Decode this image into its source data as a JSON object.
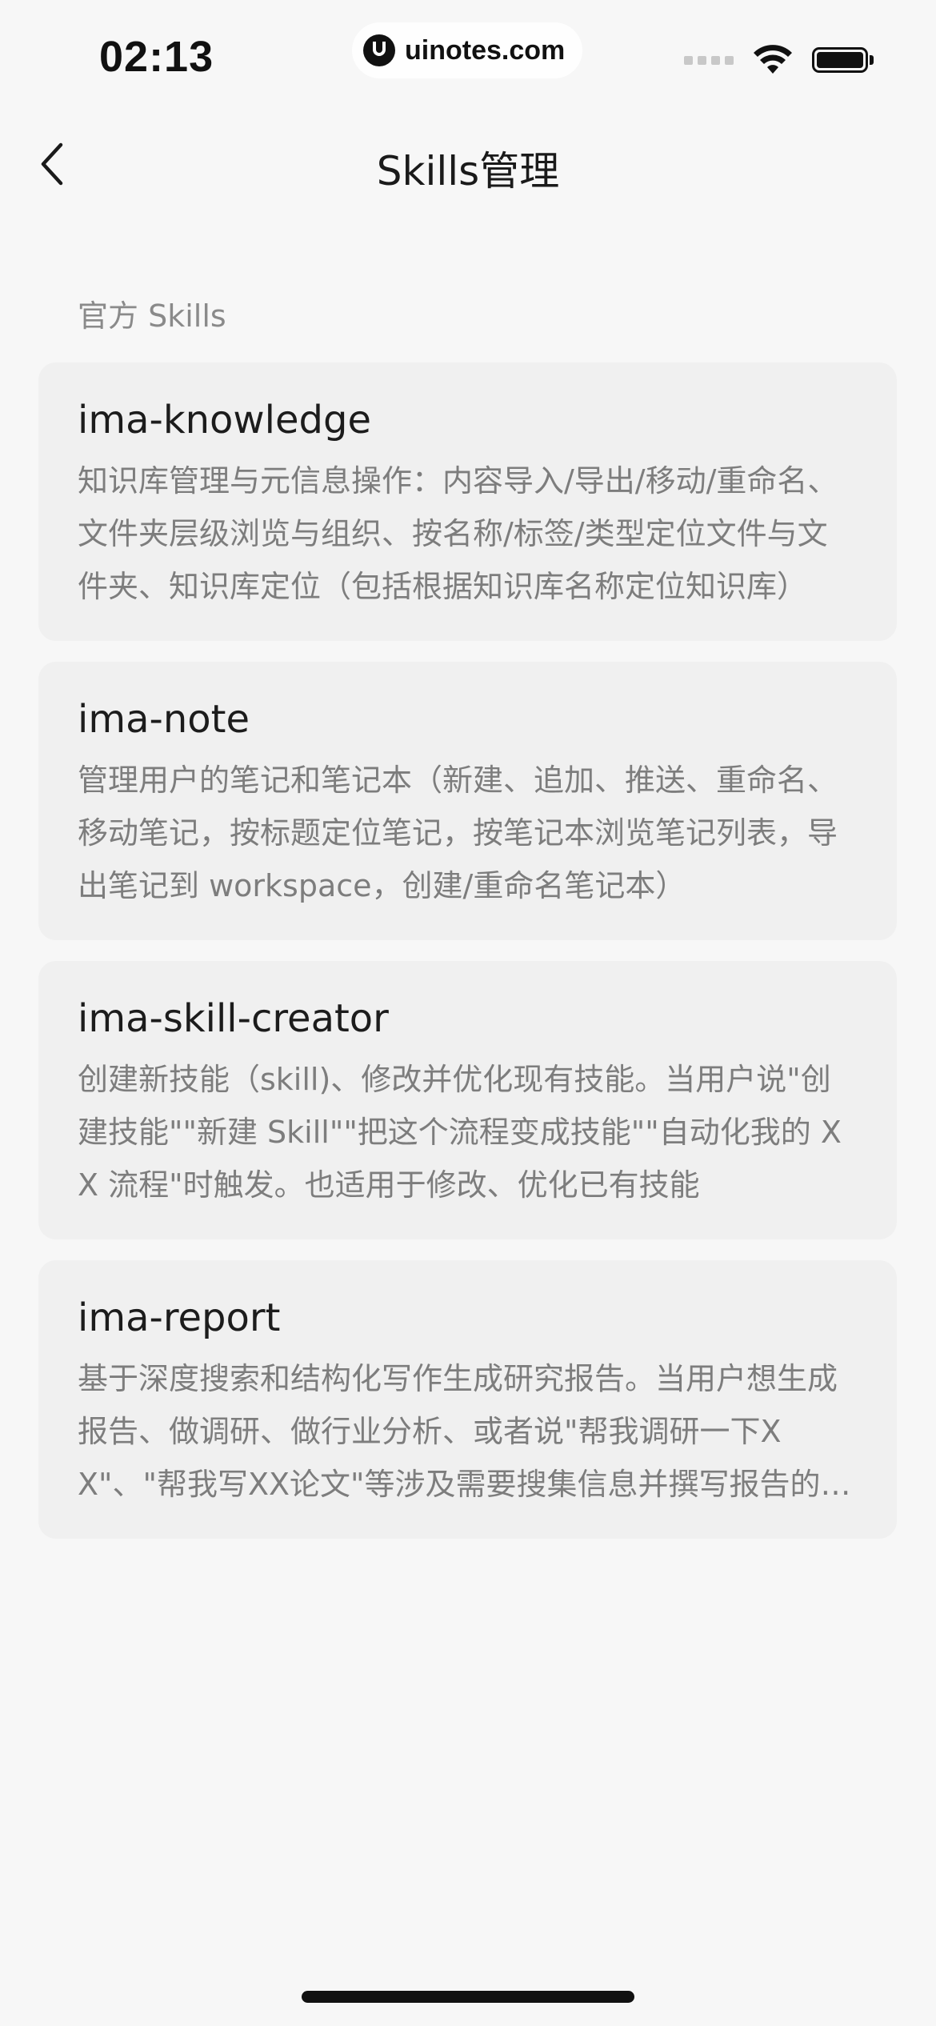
{
  "status_bar": {
    "time": "02:13",
    "watermark": "uinotes.com"
  },
  "nav": {
    "title": "Skills管理"
  },
  "section": {
    "header": "官方 Skills"
  },
  "skills": [
    {
      "name": "ima-knowledge",
      "description": "知识库管理与元信息操作：内容导入/导出/移动/重命名、文件夹层级浏览与组织、按名称/标签/类型定位文件与文件夹、知识库定位（包括根据知识库名称定位知识库）"
    },
    {
      "name": "ima-note",
      "description": "管理用户的笔记和笔记本（新建、追加、推送、重命名、移动笔记，按标题定位笔记，按笔记本浏览笔记列表，导出笔记到 workspace，创建/重命名笔记本）"
    },
    {
      "name": "ima-skill-creator",
      "description": "创建新技能（skill)、修改并优化现有技能。当用户说\"创建技能\"\"新建 Skill\"\"把这个流程变成技能\"\"自动化我的 XX 流程\"时触发。也适用于修改、优化已有技能"
    },
    {
      "name": "ima-report",
      "description": "基于深度搜索和结构化写作生成研究报告。当用户想生成报告、做调研、做行业分析、或者说\"帮我调研一下XX\"、\"帮我写XX论文\"等涉及需要搜集信息并撰写报告的场景"
    }
  ]
}
